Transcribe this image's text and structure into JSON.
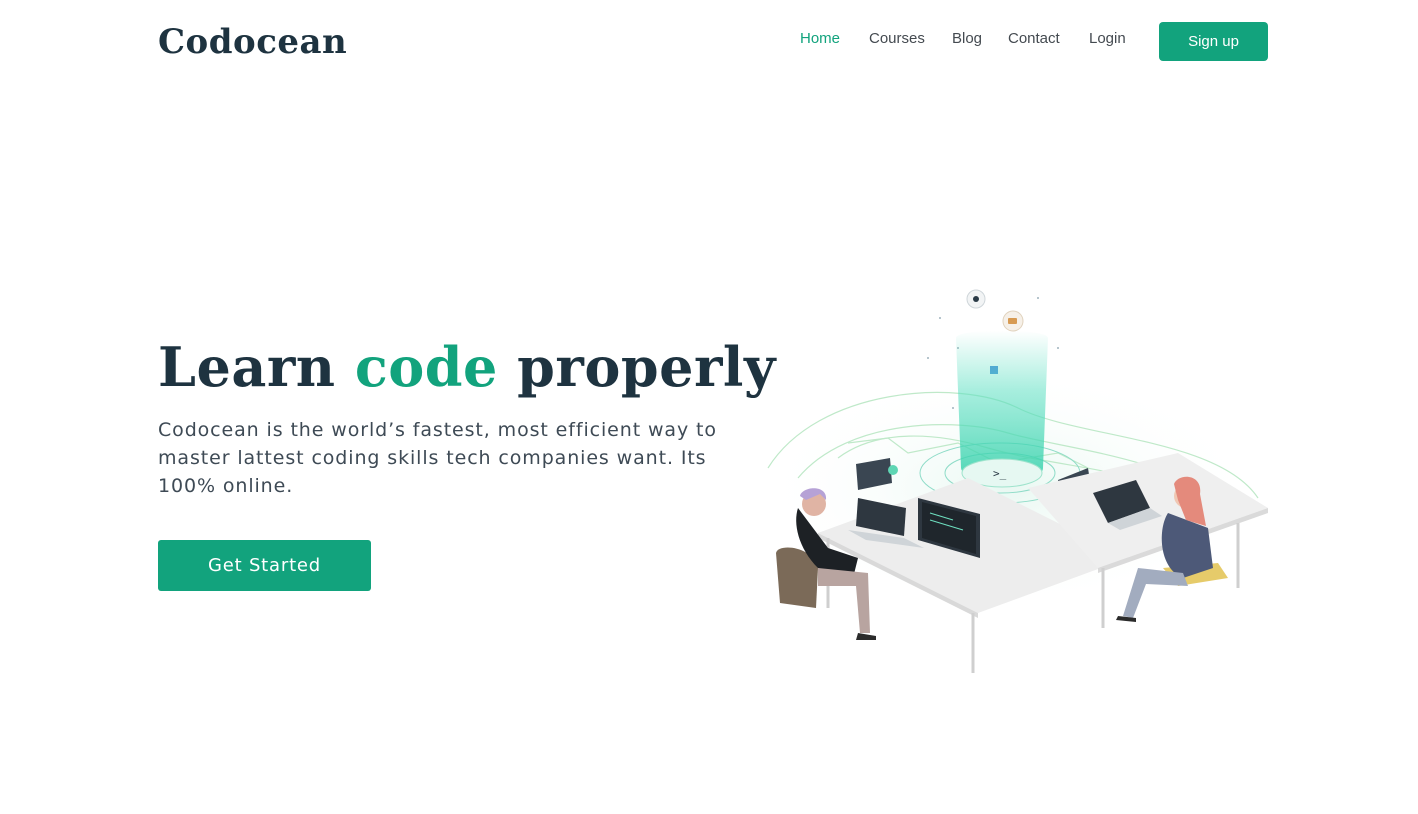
{
  "brand": {
    "name": "Codocean"
  },
  "nav": {
    "items": [
      {
        "label": "Home",
        "active": true
      },
      {
        "label": "Courses",
        "active": false
      },
      {
        "label": "Blog",
        "active": false
      },
      {
        "label": "Contact",
        "active": false
      },
      {
        "label": "Login",
        "active": false
      }
    ],
    "signup_label": "Sign up"
  },
  "hero": {
    "headline": {
      "part1": "Learn ",
      "accent": "code",
      "part2": " properly"
    },
    "description": "Codocean is the world’s fastest, most efficient way to master lattest coding skills tech companies want. Its 100% online.",
    "cta_label": "Get Started"
  },
  "illustration": {
    "terminal_prompt": ">_"
  },
  "colors": {
    "accent": "#12a37d",
    "heading": "#1e3340",
    "text": "#3e4a55"
  }
}
